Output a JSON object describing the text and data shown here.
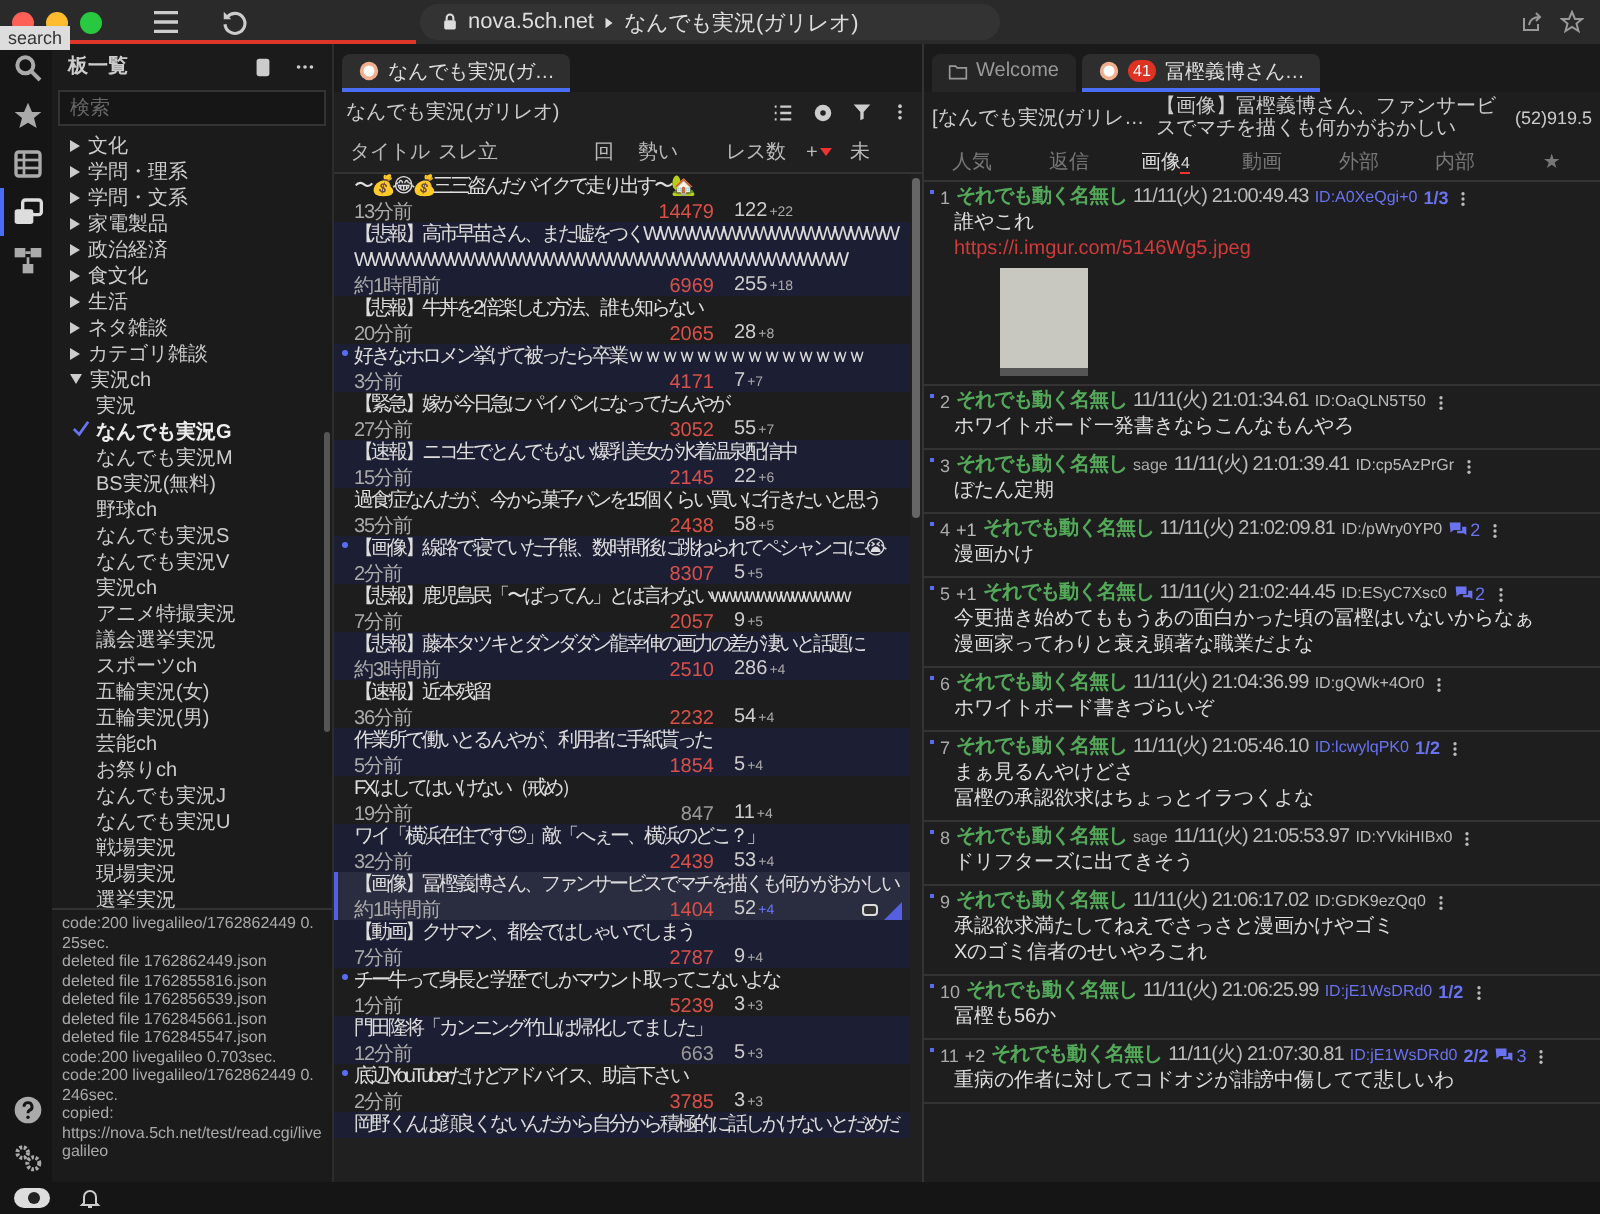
{
  "window": {
    "tooltip": "search",
    "loading": {
      "level": 0.26
    },
    "url": {
      "host": "nova.5ch.net",
      "path": "なんでも実況(ガリレオ)"
    }
  },
  "rail": {
    "items": [
      {
        "kind": "search",
        "selected": false
      },
      {
        "kind": "favorites",
        "selected": false
      },
      {
        "kind": "table",
        "selected": false
      },
      {
        "kind": "boards",
        "selected": true
      },
      {
        "kind": "tree",
        "selected": false
      }
    ],
    "bottom": [
      {
        "kind": "help"
      },
      {
        "kind": "settings"
      }
    ]
  },
  "sidebar": {
    "title": "板一覧",
    "search": {
      "placeholder": "検索"
    },
    "tree": [
      {
        "label": "文化",
        "expanded": false
      },
      {
        "label": "学問・理系",
        "expanded": false
      },
      {
        "label": "学問・文系",
        "expanded": false
      },
      {
        "label": "家電製品",
        "expanded": false
      },
      {
        "label": "政治経済",
        "expanded": false
      },
      {
        "label": "食文化",
        "expanded": false
      },
      {
        "label": "生活",
        "expanded": false
      },
      {
        "label": "ネタ雑談",
        "expanded": false
      },
      {
        "label": "カテゴリ雑談",
        "expanded": false
      },
      {
        "label": "実況ch",
        "expanded": true,
        "children": [
          {
            "label": "実況",
            "selected": false
          },
          {
            "label": "なんでも実況G",
            "selected": true
          },
          {
            "label": "なんでも実況M",
            "selected": false
          },
          {
            "label": "BS実況(無料)",
            "selected": false
          },
          {
            "label": "野球ch",
            "selected": false
          },
          {
            "label": "なんでも実況S",
            "selected": false
          },
          {
            "label": "なんでも実況V",
            "selected": false
          },
          {
            "label": "実況ch",
            "selected": false
          },
          {
            "label": "アニメ特撮実況",
            "selected": false
          },
          {
            "label": "議会選挙実況",
            "selected": false
          },
          {
            "label": "スポーツch",
            "selected": false
          },
          {
            "label": "五輪実況(女)",
            "selected": false
          },
          {
            "label": "五輪実況(男)",
            "selected": false
          },
          {
            "label": "芸能ch",
            "selected": false
          },
          {
            "label": "お祭りch",
            "selected": false
          },
          {
            "label": "なんでも実況J",
            "selected": false
          },
          {
            "label": "なんでも実況U",
            "selected": false
          },
          {
            "label": "戦場実況",
            "selected": false
          },
          {
            "label": "現場実況",
            "selected": false
          },
          {
            "label": "選挙実況",
            "selected": false
          }
        ]
      }
    ],
    "log": [
      "code:200 livegalileo/1762862449 0.25sec.",
      "deleted file 1762862449.json",
      "deleted file 1762855816.json",
      "deleted file 1762856539.json",
      "deleted file 1762845661.json",
      "deleted file 1762845547.json",
      "code:200 livegalileo 0.703sec.",
      "code:200 livegalileo/1762862449 0.246sec.",
      "copied:",
      "https://nova.5ch.net/test/read.cgi/livegalileo"
    ]
  },
  "board": {
    "tab": {
      "label": "なんでも実況(ガ…",
      "selected": true
    },
    "title": "なんでも実況(ガリレオ)",
    "columns": [
      {
        "label": "タイトル"
      },
      {
        "label": "スレ立"
      },
      {
        "label": "回"
      },
      {
        "label": "勢い"
      },
      {
        "label": "レス数"
      },
      {
        "label": "+",
        "sorted": true
      },
      {
        "label": "未"
      }
    ],
    "threads": [
      {
        "title": "〜💰😂💰三三盗んだバイクで走り出す〜🏡",
        "age": "13分前",
        "momentum": "14479",
        "hot": true,
        "count": "122",
        "new": "+22",
        "unread": false,
        "selected": false
      },
      {
        "title": "【悲報】高市早苗さん、また嘘をつくWWWWWWWWWWWWWWWWWWWWWWWWWWWWWWWWWWWWWWWWWWWWWWW",
        "age": "約1時間前",
        "momentum": "6969",
        "hot": true,
        "count": "255",
        "new": "+18",
        "unread": false,
        "selected": false
      },
      {
        "title": "【悲報】牛丼を2倍楽しむ方法、誰も知らない",
        "age": "20分前",
        "momentum": "2065",
        "hot": true,
        "count": "28",
        "new": "+8",
        "unread": false,
        "selected": false
      },
      {
        "title": "好きなホロメン挙げて被ったら卒業ｗｗｗｗｗｗｗｗｗｗｗｗｗｗ",
        "age": "3分前",
        "momentum": "4171",
        "hot": true,
        "count": "7",
        "new": "+7",
        "unread": true,
        "selected": false
      },
      {
        "title": "【緊急】嫁が今日急にパイパンになってたんやが",
        "age": "27分前",
        "momentum": "3052",
        "hot": true,
        "count": "55",
        "new": "+7",
        "unread": false,
        "selected": false
      },
      {
        "title": "【速報】ニコ生でとんでもない爆乳美女が水着温泉配信中",
        "age": "15分前",
        "momentum": "2145",
        "hot": true,
        "count": "22",
        "new": "+6",
        "unread": false,
        "selected": false
      },
      {
        "title": "過食症なんだが、今から菓子パンを15個くらい買いに行きたいと思う",
        "age": "35分前",
        "momentum": "2438",
        "hot": true,
        "count": "58",
        "new": "+5",
        "unread": false,
        "selected": false
      },
      {
        "title": "【画像】線路で寝ていた子熊、数時間後に跳ねられてペシャンコに😭",
        "age": "2分前",
        "momentum": "8307",
        "hot": true,
        "count": "5",
        "new": "+5",
        "unread": true,
        "selected": false
      },
      {
        "title": "【悲報】鹿児島民「〜ばってん」とは言わないwwwwwwwwwwww",
        "age": "7分前",
        "momentum": "2057",
        "hot": true,
        "count": "9",
        "new": "+5",
        "unread": false,
        "selected": false
      },
      {
        "title": "【悲報】藤本タツキとダンダダン龍幸伸の画力の差が凄いと話題に",
        "age": "約3時間前",
        "momentum": "2510",
        "hot": true,
        "count": "286",
        "new": "+4",
        "unread": false,
        "selected": false
      },
      {
        "title": "【速報】近本残留",
        "age": "36分前",
        "momentum": "2232",
        "hot": true,
        "count": "54",
        "new": "+4",
        "unread": false,
        "selected": false
      },
      {
        "title": "作業所で働いとるんやが、利用者に手紙貰った",
        "age": "5分前",
        "momentum": "1854",
        "hot": true,
        "count": "5",
        "new": "+4",
        "unread": false,
        "selected": false
      },
      {
        "title": "FXはしてはいけない（戒め）",
        "age": "19分前",
        "momentum": "847",
        "hot": false,
        "count": "11",
        "new": "+4",
        "unread": false,
        "selected": false
      },
      {
        "title": "ワイ「横浜在住です😊」敵「へぇー、横浜のどこ？」",
        "age": "32分前",
        "momentum": "2439",
        "hot": true,
        "count": "53",
        "new": "+4",
        "unread": false,
        "selected": false
      },
      {
        "title": "【画像】冨樫義博さん、ファンサービスでマチを描くも何かがおかしい",
        "age": "約1時間前",
        "momentum": "1404",
        "hot": true,
        "count": "52",
        "new": "+4",
        "unread": false,
        "selected": true
      },
      {
        "title": "【動画】クサマン、都会ではしゃいでしまう",
        "age": "7分前",
        "momentum": "2787",
        "hot": true,
        "count": "9",
        "new": "+4",
        "unread": false,
        "selected": false
      },
      {
        "title": "チー牛って身長と学歴でしかマウント取ってこないよな",
        "age": "1分前",
        "momentum": "5239",
        "hot": true,
        "count": "3",
        "new": "+3",
        "unread": true,
        "selected": false
      },
      {
        "title": "門田隆将「カンニング竹山は帰化してました」",
        "age": "12分前",
        "momentum": "663",
        "hot": false,
        "count": "5",
        "new": "+3",
        "unread": false,
        "selected": false
      },
      {
        "title": "底辺YouTuberだけどアドバイス、助言下さい",
        "age": "2分前",
        "momentum": "3785",
        "hot": true,
        "count": "3",
        "new": "+3",
        "unread": true,
        "selected": false
      },
      {
        "title": "岡野くんは顔良くないんだから自分から積極的に話しかけないとだめだ",
        "unread": false,
        "selected": false
      }
    ]
  },
  "thread": {
    "tabs": [
      {
        "kind": "welcome",
        "label": "Welcome",
        "selected": false
      },
      {
        "kind": "thread",
        "label": "冨樫義博さん…",
        "badge": "41",
        "selected": true
      }
    ],
    "board": "[なんでも実況(ガリレ…",
    "title": "【画像】冨樫義博さん、ファンサービスでマチを描くも何かがおかしい",
    "stats": "(52)919.5",
    "subtabs": [
      {
        "label": "人気",
        "selected": false
      },
      {
        "label": "返信",
        "selected": false
      },
      {
        "label": "画像",
        "count": "4",
        "selected": true
      },
      {
        "label": "動画",
        "selected": false
      },
      {
        "label": "外部",
        "selected": false
      },
      {
        "label": "内部",
        "selected": false
      },
      {
        "label": "★",
        "selected": false
      }
    ],
    "posts": [
      {
        "number": "1",
        "name": "それでも動く名無し",
        "date": "11/11(火) 21:00:49.43",
        "id": "ID:A0XeQgi+0",
        "id_count": "1/3",
        "body": [
          "誰やこれ"
        ],
        "link": "https://i.imgur.com/5146Wg5.jpeg",
        "image": true
      },
      {
        "number": "2",
        "name": "それでも動く名無し",
        "date": "11/11(火) 21:01:34.61",
        "id": "ID:OaQLN5T50",
        "body": [
          "ホワイトボード一発書きならこんなもんやろ"
        ]
      },
      {
        "number": "3",
        "name": "それでも動く名無し",
        "sage": "sage",
        "date": "11/11(火) 21:01:39.41",
        "id": "ID:cp5AzPrGr",
        "body": [
          "ぼたん定期"
        ]
      },
      {
        "number": "4",
        "plus": "+1",
        "name": "それでも動く名無し",
        "date": "11/11(火) 21:02:09.81",
        "id": "ID:/pWry0YP0",
        "replies": "2",
        "body": [
          "漫画かけ"
        ]
      },
      {
        "number": "5",
        "plus": "+1",
        "name": "それでも動く名無し",
        "date": "11/11(火) 21:02:44.45",
        "id": "ID:ESyC7Xsc0",
        "replies": "2",
        "body": [
          "今更描き始めてももうあの面白かった頃の冨樫はいないからなぁ",
          "漫画家ってわりと衰え顕著な職業だよな"
        ]
      },
      {
        "number": "6",
        "name": "それでも動く名無し",
        "date": "11/11(火) 21:04:36.99",
        "id": "ID:gQWk+4Or0",
        "body": [
          "ホワイトボード書きづらいぞ"
        ]
      },
      {
        "number": "7",
        "name": "それでも動く名無し",
        "date": "11/11(火) 21:05:46.10",
        "id": "ID:lcwylqPK0",
        "id_count": "1/2",
        "body": [
          "まぁ見るんやけどさ",
          "冨樫の承認欲求はちょっとイラつくよな"
        ]
      },
      {
        "number": "8",
        "name": "それでも動く名無し",
        "sage": "sage",
        "date": "11/11(火) 21:05:53.97",
        "id": "ID:YVkiHIBx0",
        "body": [
          "ドリフターズに出てきそう"
        ]
      },
      {
        "number": "9",
        "name": "それでも動く名無し",
        "date": "11/11(火) 21:06:17.02",
        "id": "ID:GDK9ezQq0",
        "body": [
          "承認欲求満たしてねえでさっさと漫画かけやゴミ",
          "Xのゴミ信者のせいやろこれ"
        ]
      },
      {
        "number": "10",
        "name": "それでも動く名無し",
        "date": "11/11(火) 21:06:25.99",
        "id": "ID:jE1WsDRd0",
        "id_count": "1/2",
        "body": [
          "冨樫も56か"
        ]
      },
      {
        "number": "11",
        "plus": "+2",
        "name": "それでも動く名無し",
        "date": "11/11(火) 21:07:30.81",
        "id": "ID:jE1WsDRd0",
        "id_count": "2/2",
        "replies": "3",
        "body": [
          "重病の作者に対してコドオジが誹謗中傷してて悲しいわ"
        ]
      }
    ]
  },
  "status_bar": {
    "toggle": {
      "on": true
    }
  }
}
